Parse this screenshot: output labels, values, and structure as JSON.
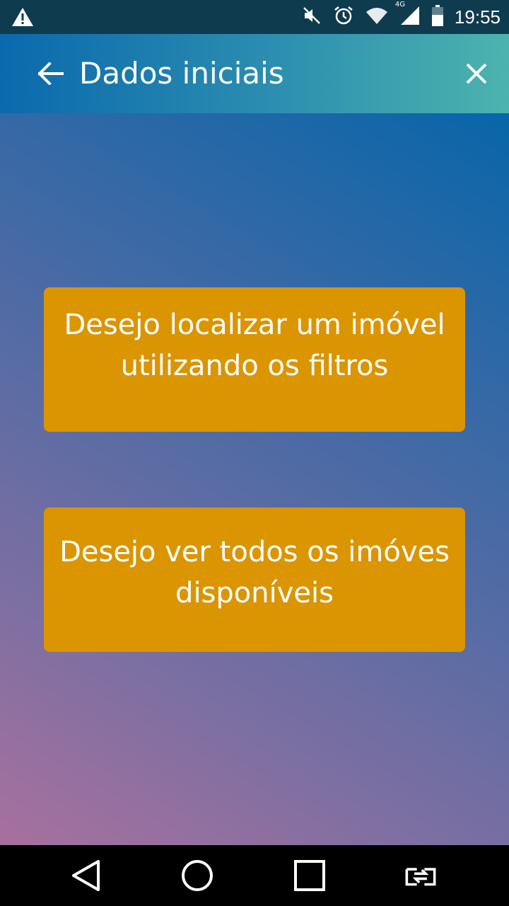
{
  "status_bar": {
    "time": "19:55",
    "network": "4G",
    "icons": [
      "warning-icon",
      "mute-icon",
      "alarm-icon",
      "wifi-icon",
      "signal-icon",
      "battery-icon"
    ]
  },
  "app_bar": {
    "title": "Dados iniciais",
    "back_icon": "arrow-back-icon",
    "close_icon": "close-icon"
  },
  "options": [
    {
      "line1": "Desejo localizar um imóvel",
      "line2": "utilizando os filtros"
    },
    {
      "line1": "Desejo ver todos os imóves ",
      "line2": "disponíveis"
    }
  ],
  "nav_bar": {
    "icons": [
      "back-triangle-icon",
      "home-circle-icon",
      "recents-square-icon",
      "switch-app-icon"
    ]
  },
  "colors": {
    "status_bar": "#0f3b4f",
    "button": "#da9500",
    "app_bar_start": "#0a69ad",
    "app_bar_end": "#4db3ae",
    "background_top": "#0866a9",
    "background_bottom": "#a8709e"
  }
}
